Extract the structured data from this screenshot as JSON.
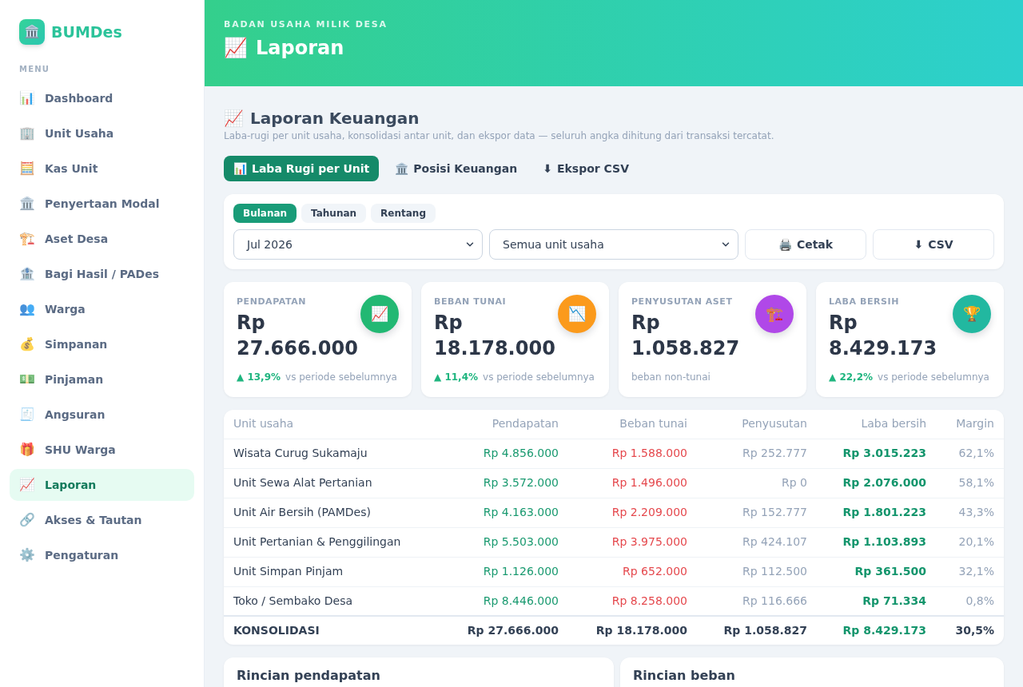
{
  "sidebar": {
    "logo": {
      "icon": "🏛️",
      "title": "BUMDes"
    },
    "section_label": "MENU",
    "items": [
      {
        "icon": "📊",
        "label": "Dashboard",
        "selected": false
      },
      {
        "icon": "🏢",
        "label": "Unit Usaha",
        "selected": false
      },
      {
        "icon": "🧮",
        "label": "Kas Unit",
        "selected": false
      },
      {
        "icon": "🏛️",
        "label": "Penyertaan Modal",
        "selected": false
      },
      {
        "icon": "🏗️",
        "label": "Aset Desa",
        "selected": false
      },
      {
        "icon": "🏦",
        "label": "Bagi Hasil / PADes",
        "selected": false
      },
      {
        "icon": "👥",
        "label": "Warga",
        "selected": false
      },
      {
        "icon": "💰",
        "label": "Simpanan",
        "selected": false
      },
      {
        "icon": "💵",
        "label": "Pinjaman",
        "selected": false
      },
      {
        "icon": "🧾",
        "label": "Angsuran",
        "selected": false
      },
      {
        "icon": "🎁",
        "label": "SHU Warga",
        "selected": false
      },
      {
        "icon": "📈",
        "label": "Laporan",
        "selected": true
      },
      {
        "icon": "🔗",
        "label": "Akses & Tautan",
        "selected": false
      },
      {
        "icon": "⚙️",
        "label": "Pengaturan",
        "selected": false
      }
    ]
  },
  "header": {
    "eyebrow": "BADAN USAHA MILIK DESA",
    "icon": "📈",
    "title": "Laporan"
  },
  "page": {
    "icon": "📈",
    "title": "Laporan Keuangan",
    "subtitle": "Laba-rugi per unit usaha, konsolidasi antar unit, dan ekspor data — seluruh angka dihitung dari transaksi tercatat."
  },
  "tabs": [
    {
      "icon": "📊",
      "label": "Laba Rugi per Unit",
      "selected": true
    },
    {
      "icon": "🏛️",
      "label": "Posisi Keuangan",
      "selected": false
    },
    {
      "icon": "⬇",
      "label": "Ekspor CSV",
      "selected": false
    }
  ],
  "filters": {
    "periods": [
      {
        "label": "Bulanan",
        "selected": true
      },
      {
        "label": "Tahunan",
        "selected": false
      },
      {
        "label": "Rentang",
        "selected": false
      }
    ],
    "selects": [
      {
        "value": "Jul 2026"
      },
      {
        "value": "Semua unit usaha"
      }
    ],
    "buttons": [
      {
        "icon": "🖨️",
        "label": "Cetak"
      },
      {
        "icon": "⬇",
        "label": "CSV"
      }
    ]
  },
  "kpis": [
    {
      "label": "PENDAPATAN",
      "value": "Rp 27.666.000",
      "icon": "📈",
      "color": "#22b873",
      "delta": "▲ 13,9%",
      "note": "vs periode sebelumnya"
    },
    {
      "label": "BEBAN TUNAI",
      "value": "Rp 18.178.000",
      "icon": "📉",
      "color": "#fb9a1c",
      "delta": "▲ 11,4%",
      "note": "vs periode sebelumnya"
    },
    {
      "label": "PENYUSUTAN ASET",
      "value": "Rp 1.058.827",
      "icon": "🏗️",
      "color": "#b048e8",
      "note": "beban non-tunai"
    },
    {
      "label": "LABA BERSIH",
      "value": "Rp 8.429.173",
      "icon": "🏆",
      "color": "#22b8a0",
      "delta": "▲ 22,2%",
      "note": "vs periode sebelumnya"
    }
  ],
  "table": {
    "columns": [
      "Unit usaha",
      "Pendapatan",
      "Beban tunai",
      "Penyusutan",
      "Laba bersih",
      "Margin"
    ],
    "rows": [
      [
        "Wisata Curug Sukamaju",
        "Rp 4.856.000",
        "Rp 1.588.000",
        "Rp 252.777",
        "Rp 3.015.223",
        "62,1%"
      ],
      [
        "Unit Sewa Alat Pertanian",
        "Rp 3.572.000",
        "Rp 1.496.000",
        "Rp 0",
        "Rp 2.076.000",
        "58,1%"
      ],
      [
        "Unit Air Bersih (PAMDes)",
        "Rp 4.163.000",
        "Rp 2.209.000",
        "Rp 152.777",
        "Rp 1.801.223",
        "43,3%"
      ],
      [
        "Unit Pertanian & Penggilingan",
        "Rp 5.503.000",
        "Rp 3.975.000",
        "Rp 424.107",
        "Rp 1.103.893",
        "20,1%"
      ],
      [
        "Unit Simpan Pinjam",
        "Rp 1.126.000",
        "Rp 652.000",
        "Rp 112.500",
        "Rp 361.500",
        "32,1%"
      ],
      [
        "Toko / Sembako Desa",
        "Rp 8.446.000",
        "Rp 8.258.000",
        "Rp 116.666",
        "Rp 71.334",
        "0,8%"
      ]
    ],
    "total": [
      "KONSOLIDASI",
      "Rp 27.666.000",
      "Rp 18.178.000",
      "Rp 1.058.827",
      "Rp 8.429.173",
      "30,5%"
    ]
  },
  "panels": [
    {
      "title": "Rincian pendapatan"
    },
    {
      "title": "Rincian beban"
    }
  ]
}
